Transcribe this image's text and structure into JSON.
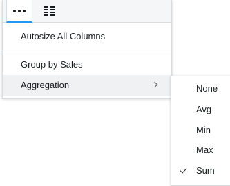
{
  "tabs": [
    {
      "icon": "more-horizontal-icon",
      "selected": true
    },
    {
      "icon": "columns-icon",
      "selected": false
    }
  ],
  "menu": {
    "items": [
      {
        "label": "Autosize All Columns"
      },
      {
        "label": "Group by Sales"
      },
      {
        "label": "Aggregation",
        "has_submenu": true
      }
    ]
  },
  "aggregation_submenu": {
    "options": [
      "None",
      "Avg",
      "Min",
      "Max",
      "Sum"
    ],
    "selected": "Sum"
  },
  "colors": {
    "accent": "#2196f3",
    "hover": "#f0f1f2",
    "border": "#d9dcde"
  }
}
